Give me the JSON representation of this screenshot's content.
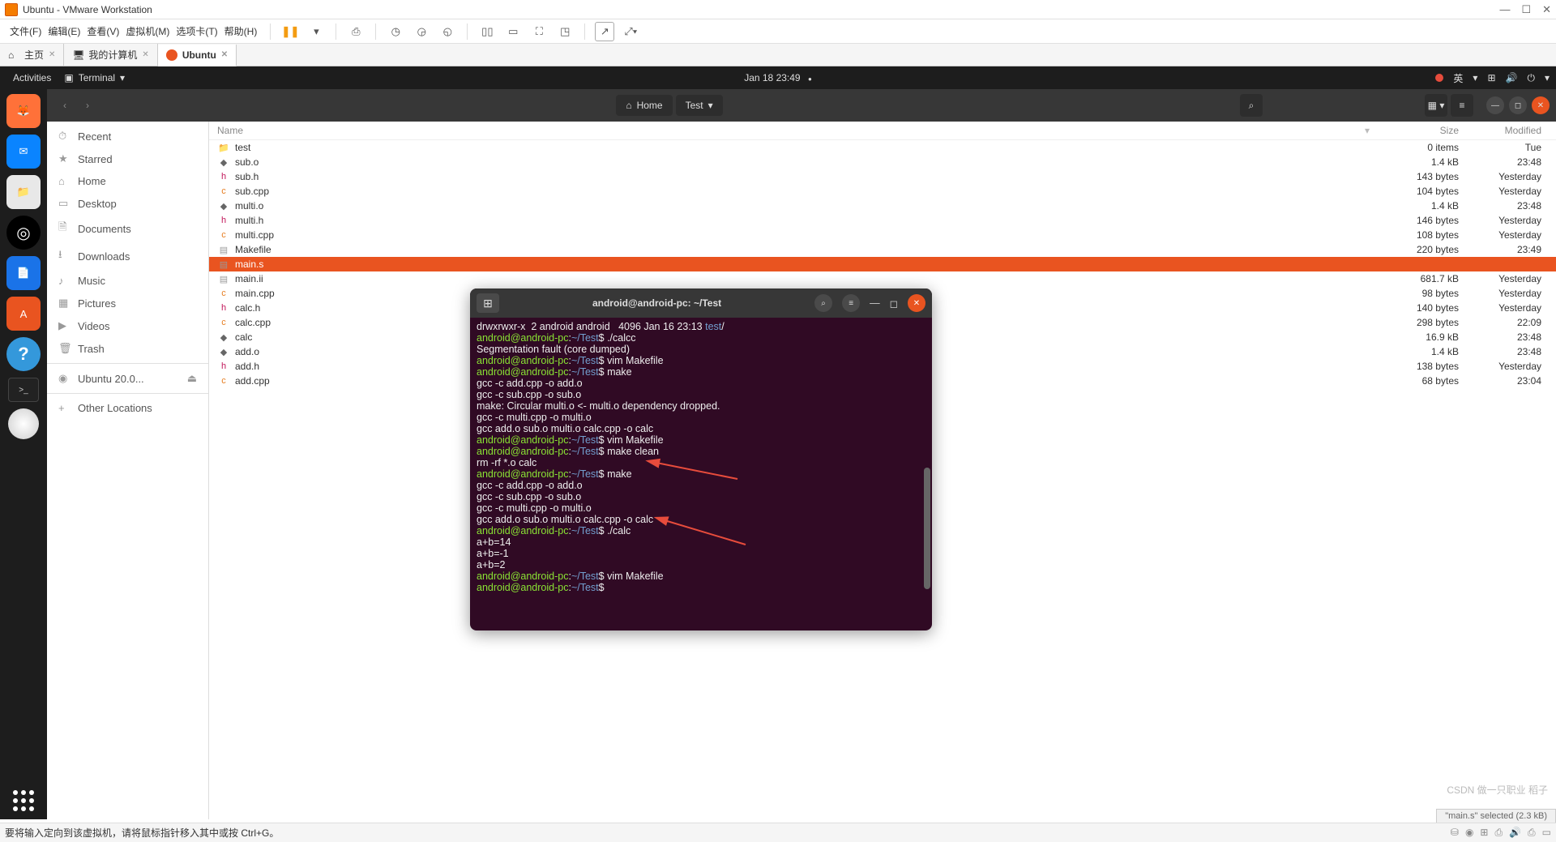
{
  "vmware": {
    "title": "Ubuntu - VMware Workstation",
    "menu": [
      "文件(F)",
      "编辑(E)",
      "查看(V)",
      "虚拟机(M)",
      "选项卡(T)",
      "帮助(H)"
    ],
    "tabs": [
      {
        "label": "主页",
        "icon": "home"
      },
      {
        "label": "我的计算机",
        "icon": "computer"
      },
      {
        "label": "Ubuntu",
        "icon": "ubuntu",
        "active": true
      }
    ],
    "status": "要将输入定向到该虚拟机，请将鼠标指针移入其中或按 Ctrl+G。"
  },
  "ubuntu_top": {
    "activities": "Activities",
    "app": "Terminal",
    "clock": "Jan 18  23:49",
    "lang": "英"
  },
  "nautilus": {
    "path": [
      {
        "label": "Home",
        "icon": "home"
      },
      {
        "label": "Test",
        "icon": "caret"
      }
    ],
    "columns": {
      "name": "Name",
      "size": "Size",
      "modified": "Modified"
    },
    "sidebar": [
      {
        "label": "Recent",
        "icon": "⏱"
      },
      {
        "label": "Starred",
        "icon": "★"
      },
      {
        "label": "Home",
        "icon": "⌂"
      },
      {
        "label": "Desktop",
        "icon": "▭"
      },
      {
        "label": "Documents",
        "icon": "🗎"
      },
      {
        "label": "Downloads",
        "icon": "⭳"
      },
      {
        "label": "Music",
        "icon": "♪"
      },
      {
        "label": "Pictures",
        "icon": "▦"
      },
      {
        "label": "Videos",
        "icon": "▶"
      },
      {
        "label": "Trash",
        "icon": "🗑"
      },
      {
        "sep": true
      },
      {
        "label": "Ubuntu 20.0...",
        "icon": "◉",
        "eject": true
      },
      {
        "sep": true
      },
      {
        "label": "Other Locations",
        "icon": "+"
      }
    ],
    "files": [
      {
        "name": "test",
        "size": "0 items",
        "mod": "Tue",
        "icon": "📁",
        "cls": "ico-folder"
      },
      {
        "name": "sub.o",
        "size": "1.4 kB",
        "mod": "23:48",
        "icon": "◆",
        "cls": "ico-obj"
      },
      {
        "name": "sub.h",
        "size": "143 bytes",
        "mod": "Yesterday",
        "icon": "h",
        "cls": "ico-header"
      },
      {
        "name": "sub.cpp",
        "size": "104 bytes",
        "mod": "Yesterday",
        "icon": "c",
        "cls": "ico-cpp"
      },
      {
        "name": "multi.o",
        "size": "1.4 kB",
        "mod": "23:48",
        "icon": "◆",
        "cls": "ico-obj"
      },
      {
        "name": "multi.h",
        "size": "146 bytes",
        "mod": "Yesterday",
        "icon": "h",
        "cls": "ico-header"
      },
      {
        "name": "multi.cpp",
        "size": "108 bytes",
        "mod": "Yesterday",
        "icon": "c",
        "cls": "ico-cpp"
      },
      {
        "name": "Makefile",
        "size": "220 bytes",
        "mod": "23:49",
        "icon": "▤",
        "cls": "ico-make"
      },
      {
        "name": "main.s",
        "size": "",
        "mod": "",
        "icon": "▤",
        "cls": "ico-make",
        "selected": true
      },
      {
        "name": "main.ii",
        "size": "681.7 kB",
        "mod": "Yesterday",
        "icon": "▤",
        "cls": "ico-make"
      },
      {
        "name": "main.cpp",
        "size": "98 bytes",
        "mod": "Yesterday",
        "icon": "c",
        "cls": "ico-cpp"
      },
      {
        "name": "calc.h",
        "size": "140 bytes",
        "mod": "Yesterday",
        "icon": "h",
        "cls": "ico-header"
      },
      {
        "name": "calc.cpp",
        "size": "298 bytes",
        "mod": "22:09",
        "icon": "c",
        "cls": "ico-cpp"
      },
      {
        "name": "calc",
        "size": "16.9 kB",
        "mod": "23:48",
        "icon": "◆",
        "cls": "ico-obj"
      },
      {
        "name": "add.o",
        "size": "1.4 kB",
        "mod": "23:48",
        "icon": "◆",
        "cls": "ico-obj"
      },
      {
        "name": "add.h",
        "size": "138 bytes",
        "mod": "Yesterday",
        "icon": "h",
        "cls": "ico-header"
      },
      {
        "name": "add.cpp",
        "size": "68 bytes",
        "mod": "23:04",
        "icon": "c",
        "cls": "ico-cpp"
      }
    ],
    "status": "\"main.s\" selected  (2.3 kB)"
  },
  "terminal": {
    "title": "android@android-pc: ~/Test",
    "prompt_user": "android@android-pc",
    "prompt_path": "~/Test",
    "lines": [
      {
        "t": "out",
        "text": "drwxrwxr-x  2 android android   4096 Jan 16 23:13 ",
        "suffix": "test",
        "suffix_cls": "b",
        "tail": "/"
      },
      {
        "t": "cmd",
        "text": "./calcc"
      },
      {
        "t": "out",
        "text": "Segmentation fault (core dumped)"
      },
      {
        "t": "cmd",
        "text": "vim Makefile"
      },
      {
        "t": "cmd",
        "text": "make"
      },
      {
        "t": "out",
        "text": "gcc -c add.cpp -o add.o"
      },
      {
        "t": "out",
        "text": "gcc -c sub.cpp -o sub.o"
      },
      {
        "t": "out",
        "text": "make: Circular multi.o <- multi.o dependency dropped."
      },
      {
        "t": "out",
        "text": "gcc -c multi.cpp -o multi.o"
      },
      {
        "t": "out",
        "text": "gcc add.o sub.o multi.o calc.cpp -o calc"
      },
      {
        "t": "cmd",
        "text": "vim Makefile"
      },
      {
        "t": "cmd",
        "text": "make clean"
      },
      {
        "t": "out",
        "text": "rm -rf *.o calc"
      },
      {
        "t": "cmd",
        "text": "make"
      },
      {
        "t": "out",
        "text": "gcc -c add.cpp -o add.o"
      },
      {
        "t": "out",
        "text": "gcc -c sub.cpp -o sub.o"
      },
      {
        "t": "out",
        "text": "gcc -c multi.cpp -o multi.o"
      },
      {
        "t": "out",
        "text": "gcc add.o sub.o multi.o calc.cpp -o calc"
      },
      {
        "t": "cmd",
        "text": "./calc"
      },
      {
        "t": "out",
        "text": "a+b=14"
      },
      {
        "t": "out",
        "text": "a+b=-1"
      },
      {
        "t": "out",
        "text": "a+b=2"
      },
      {
        "t": "cmd",
        "text": "vim Makefile"
      },
      {
        "t": "cmd",
        "text": ""
      }
    ]
  },
  "watermark": "CSDN 做一只职业 稻子"
}
